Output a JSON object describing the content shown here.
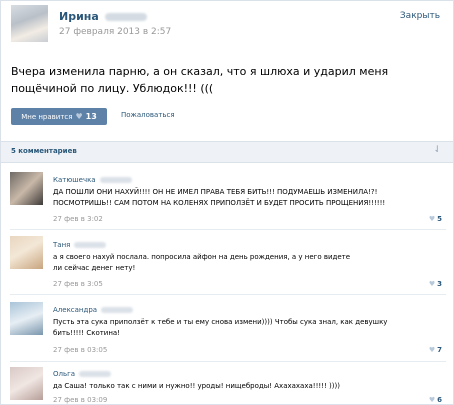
{
  "post": {
    "author_first": "Ирина",
    "date": "27 февраля 2013 в 2:57",
    "close_label": "Закрыть",
    "text": "Вчера изменила парню, а он сказал, что я шлюха и ударил меня пощёчиной по лицу. Ублюдок!!! (((",
    "like_label": "Мне нравится",
    "like_count": "13",
    "complain_label": "Пожаловаться"
  },
  "comments_header": {
    "count_label": "5 комментариев"
  },
  "comments": [
    {
      "name": "Катюшечка",
      "text": "ДА ПОШЛИ ОНИ НАХУЙ!!!! ОН НЕ ИМЕЛ ПРАВА ТЕБЯ БИТЬ!!! ПОДУМАЕШЬ ИЗМЕНИЛА!?! ПОСМОТРИШЬ!! САМ ПОТОМ НА КОЛЕНЯХ ПРИПОЛЗЁТ И БУДЕТ ПРОСИТЬ ПРОЩЕНИЯ!!!!!!",
      "date": "27 фев в 3:02",
      "likes": "5"
    },
    {
      "name": "Таня",
      "text": "а я своего нахуй послала. попросила айфон на день рождения, а у него видете ли сейчас денег нету!",
      "date": "27 фев в 3:05",
      "likes": "3"
    },
    {
      "name": "Александра",
      "text": "Пусть эта сука приползёт к тебе и ты ему снова измени)))) Чтобы сука знал, как девушку бить!!!!! Скотина!",
      "date": "27 фев в 03:05",
      "likes": "7"
    },
    {
      "name": "Ольга",
      "text": "да Саша! только так с ними и нужно!! уроды! нищеброды! Ахахахаха!!!!! ))))",
      "date": "27 фев в 03:09",
      "likes": "6"
    }
  ]
}
